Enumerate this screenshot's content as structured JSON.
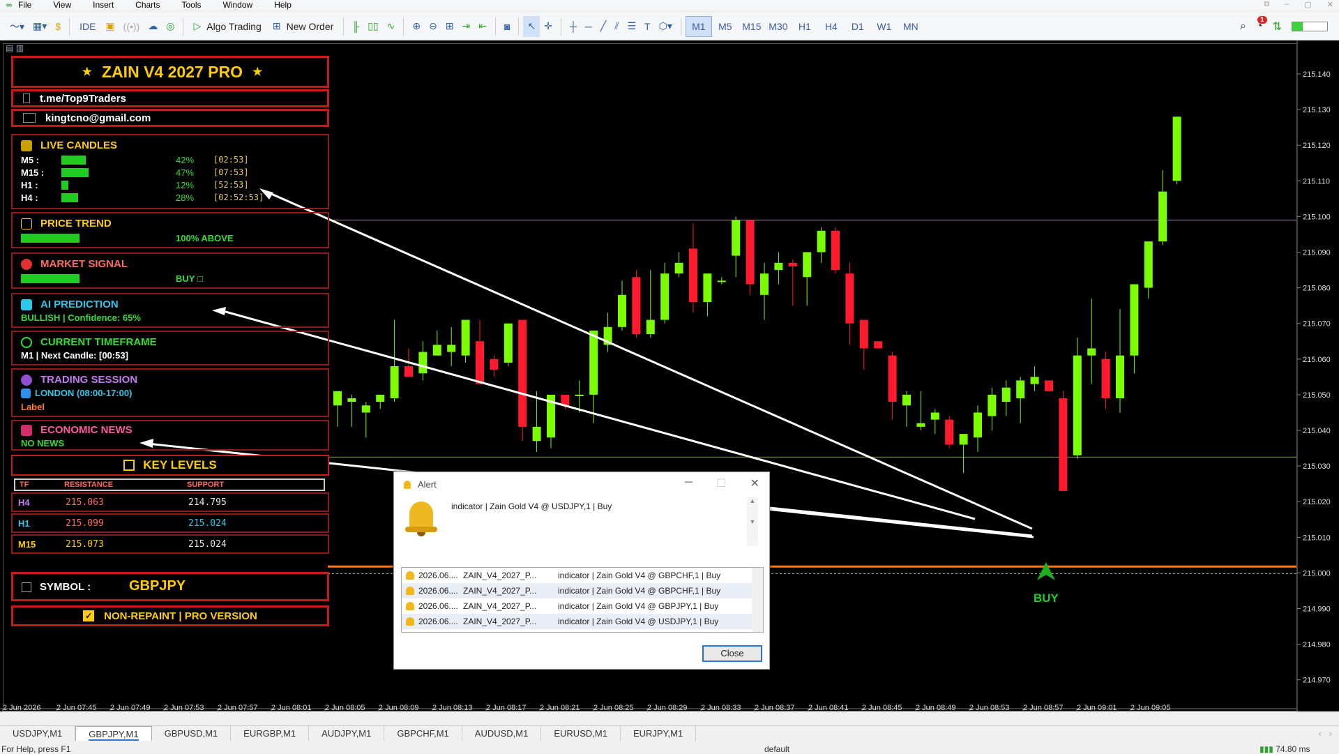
{
  "menu": [
    "File",
    "View",
    "Insert",
    "Charts",
    "Tools",
    "Window",
    "Help"
  ],
  "toolbar": {
    "ide": "IDE",
    "algo_trading": "Algo Trading",
    "new_order": "New Order",
    "timeframes": [
      "M1",
      "M5",
      "M15",
      "M30",
      "H1",
      "H4",
      "D1",
      "W1",
      "MN"
    ],
    "active_timeframe": "M1",
    "notification_count": "1"
  },
  "panel": {
    "title": "ZAIN V4 2027 PRO",
    "telegram": "t.me/Top9Traders",
    "email": "kingtcno@gmail.com",
    "live_candles": {
      "heading": "LIVE CANDLES",
      "rows": [
        {
          "tf": "M5 :",
          "progress": 0.42,
          "pct": "42%",
          "timer": "[02:53]"
        },
        {
          "tf": "M15 :",
          "progress": 0.47,
          "pct": "47%",
          "timer": "[07:53]"
        },
        {
          "tf": "H1 :",
          "progress": 0.12,
          "pct": "12%",
          "timer": "[52:53]"
        },
        {
          "tf": "H4 :",
          "progress": 0.28,
          "pct": "28%",
          "timer": "[02:52:53]"
        }
      ]
    },
    "price_trend": {
      "heading": "PRICE TREND",
      "value": "100%  ABOVE",
      "progress": 1.0
    },
    "market_signal": {
      "heading": "MARKET SIGNAL",
      "value": "BUY  □",
      "progress": 1.0
    },
    "ai_prediction": {
      "heading": "AI PREDICTION",
      "value": "BULLISH  |  Confidence: 65%"
    },
    "current_timeframe": {
      "heading": "CURRENT TIMEFRAME",
      "value": "M1  |  Next Candle: [00:53]"
    },
    "trading_session": {
      "heading": "TRADING SESSION",
      "value": "LONDON  (08:00-17:00)",
      "label": "Label"
    },
    "economic_news": {
      "heading": "ECONOMIC NEWS",
      "value": "NO NEWS"
    },
    "key_levels": {
      "heading": "KEY LEVELS",
      "columns": [
        "TF",
        "RESISTANCE",
        "SUPPORT"
      ],
      "rows": [
        {
          "tf": "H4",
          "resistance": "215.063",
          "support": "214.795"
        },
        {
          "tf": "H1",
          "resistance": "215.099",
          "support": "215.024"
        },
        {
          "tf": "M15",
          "resistance": "215.073",
          "support": "215.024"
        }
      ]
    },
    "symbol_label": "SYMBOL :",
    "symbol_value": "GBPJPY",
    "footer": "NON-REPAINT  |  PRO VERSION"
  },
  "chart": {
    "price_labels": [
      "215.140",
      "215.130",
      "215.120",
      "215.110",
      "215.100",
      "215.090",
      "215.080",
      "215.070",
      "215.060",
      "215.050",
      "215.040",
      "215.030",
      "215.020",
      "215.010",
      "215.000",
      "214.990",
      "214.980",
      "214.970"
    ],
    "time_labels": [
      "2 Jun 2026",
      "2 Jun 07:45",
      "2 Jun 07:49",
      "2 Jun 07:53",
      "2 Jun 07:57",
      "2 Jun 08:01",
      "2 Jun 08:05",
      "2 Jun 08:09",
      "2 Jun 08:13",
      "2 Jun 08:17",
      "2 Jun 08:21",
      "2 Jun 08:25",
      "2 Jun 08:29",
      "2 Jun 08:33",
      "2 Jun 08:37",
      "2 Jun 08:41",
      "2 Jun 08:45",
      "2 Jun 08:49",
      "2 Jun 08:53",
      "2 Jun 08:57",
      "2 Jun 09:01",
      "2 Jun 09:05"
    ],
    "buy_label": "BUY",
    "bull_color": "#7cfc00",
    "bear_color": "#ff1a2e"
  },
  "alert": {
    "title": "Alert",
    "message": "indicator | Zain Gold V4 @ USDJPY,1 | Buy",
    "rows": [
      {
        "date": "2026.06....",
        "name": "ZAIN_V4_2027_P...",
        "msg": "indicator | Zain Gold V4 @ GBPCHF,1 | Buy"
      },
      {
        "date": "2026.06....",
        "name": "ZAIN_V4_2027_P...",
        "msg": "indicator | Zain Gold V4 @ GBPCHF,1 | Buy"
      },
      {
        "date": "2026.06....",
        "name": "ZAIN_V4_2027_P...",
        "msg": "indicator | Zain Gold V4 @ GBPJPY,1 | Buy"
      },
      {
        "date": "2026.06....",
        "name": "ZAIN_V4_2027_P...",
        "msg": "indicator | Zain Gold V4 @ USDJPY,1 | Buy"
      }
    ],
    "close": "Close"
  },
  "tabs": [
    "USDJPY,M1",
    "GBPJPY,M1",
    "GBPUSD,M1",
    "EURGBP,M1",
    "AUDJPY,M1",
    "GBPCHF,M1",
    "AUDUSD,M1",
    "EURUSD,M1",
    "EURJPY,M1"
  ],
  "active_tab": "GBPJPY,M1",
  "status": {
    "help": "For Help, press F1",
    "profile": "default",
    "ping": "74.80 ms"
  }
}
